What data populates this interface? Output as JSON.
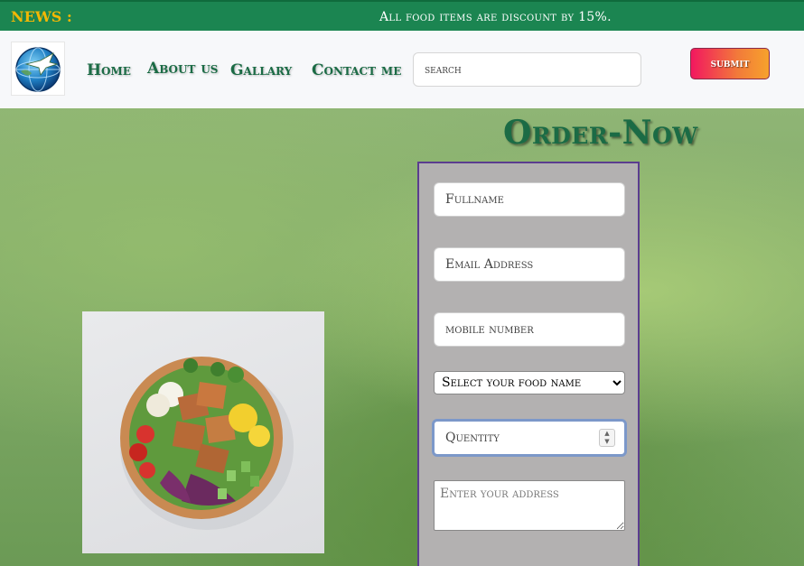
{
  "news": {
    "label": "NEWS :",
    "text": "All food items are discount by 15%."
  },
  "nav": {
    "logo_icon": "globe-bird-logo",
    "links": [
      "Home",
      "About us",
      "Gallary",
      "Contact me"
    ],
    "search_placeholder": "search",
    "submit_label": "submit"
  },
  "order": {
    "title": "Order-Now",
    "fullname_placeholder": "Fullname",
    "email_placeholder": "Email Address",
    "mobile_placeholder": "mobile number",
    "food_select_label": "Select your food name",
    "quantity_placeholder": "Quentity",
    "address_placeholder": "Enter your address"
  },
  "colors": {
    "news_bg": "#1b8551",
    "news_label": "#f2b705",
    "nav_link": "#1b6b45",
    "form_bg": "#b3b1b1",
    "form_border": "#5b3d8f"
  }
}
